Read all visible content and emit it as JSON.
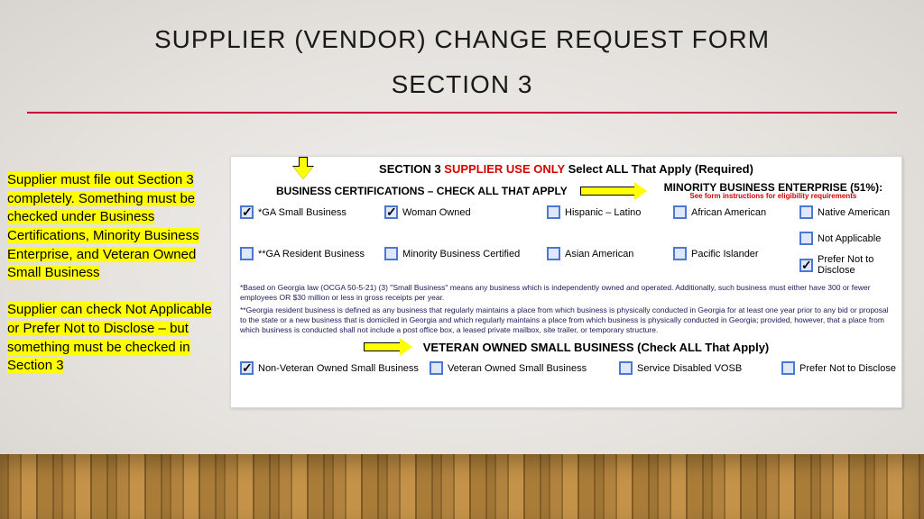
{
  "title": "SUPPLIER (VENDOR) CHANGE REQUEST FORM",
  "subtitle": "SECTION 3",
  "notes": {
    "p1": "Supplier must file out Section 3 completely. Something must be checked under Business Certifications, Minority Business Enterprise, and Veteran Owned Small Business",
    "p2": "Supplier can check Not Applicable or Prefer Not to Disclose – but something must be checked in Section 3"
  },
  "section_header": {
    "prefix": "SECTION 3 ",
    "red": "SUPPLIER USE ONLY",
    "suffix": " Select ALL That Apply (Required)"
  },
  "groups": {
    "biz_label": "BUSINESS CERTIFICATIONS – CHECK ALL THAT APPLY",
    "mbe_label": "MINORITY BUSINESS ENTERPRISE (51%):",
    "mbe_sub": "See form instructions for eligibility requirements",
    "vet_label": "VETERAN OWNED SMALL BUSINESS (Check ALL That Apply)"
  },
  "checks": {
    "ga_small": {
      "label": "*GA Small Business",
      "checked": true
    },
    "woman": {
      "label": "Woman Owned",
      "checked": true
    },
    "hispanic": {
      "label": "Hispanic – Latino",
      "checked": false
    },
    "african": {
      "label": "African American",
      "checked": false
    },
    "native": {
      "label": "Native American",
      "checked": false
    },
    "ga_res": {
      "label": "**GA Resident Business",
      "checked": false
    },
    "mbc": {
      "label": "Minority Business Certified",
      "checked": false
    },
    "asian": {
      "label": "Asian American",
      "checked": false
    },
    "pacific": {
      "label": "Pacific Islander",
      "checked": false
    },
    "na": {
      "label": "Not Applicable",
      "checked": false
    },
    "pnd": {
      "label": "Prefer Not to Disclose",
      "checked": true
    },
    "vet_non": {
      "label": "Non-Veteran Owned Small Business",
      "checked": true
    },
    "vet_own": {
      "label": "Veteran Owned Small Business",
      "checked": false
    },
    "vet_sd": {
      "label": "Service Disabled VOSB",
      "checked": false
    },
    "vet_pnd": {
      "label": "Prefer Not to Disclose",
      "checked": false
    }
  },
  "fineprint": {
    "p1": "*Based on Georgia law (OCGA 50-5-21) (3) \"Small Business\" means any business which is independently owned and operated. Additionally, such business must either have 300 or fewer employees OR $30 million or less in gross receipts per year.",
    "p2": "**Georgia resident business is defined as any business that regularly maintains a place from which business is physically conducted in Georgia for at least one year prior to any bid or proposal to the state or a new business that is domiciled in Georgia and which regularly maintains a place from which business is physically conducted in Georgia; provided, however, that a place from which business is conducted shall not include a post office box, a leased private mailbox, site trailer, or temporary structure."
  }
}
